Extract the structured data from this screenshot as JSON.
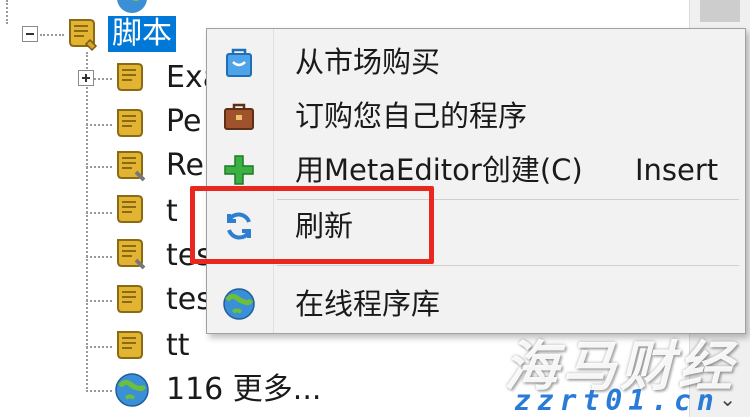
{
  "tree": {
    "root": {
      "label": "脚本",
      "expanded": true
    },
    "children": [
      {
        "label": "Exa",
        "icon": "script-icon",
        "expandable": true
      },
      {
        "label": "Pe",
        "icon": "script-icon",
        "expandable": false
      },
      {
        "label": "Re",
        "icon": "script-icon",
        "expandable": false
      },
      {
        "label": "t",
        "icon": "script-icon",
        "expandable": false
      },
      {
        "label": "tes",
        "icon": "script-icon",
        "expandable": false
      },
      {
        "label": "tes",
        "icon": "script-icon",
        "expandable": false
      },
      {
        "label": "tt",
        "icon": "script-icon",
        "expandable": false
      },
      {
        "label": "116 更多...",
        "icon": "globe-icon",
        "expandable": false
      }
    ]
  },
  "context_menu": {
    "items": [
      {
        "label": "从市场购买",
        "icon": "market-bag-icon",
        "shortcut": ""
      },
      {
        "label": "订购您自己的程序",
        "icon": "briefcase-icon",
        "shortcut": ""
      },
      {
        "label": "用MetaEditor创建(C)",
        "icon": "green-plus-icon",
        "shortcut": "Insert"
      },
      {
        "label": "刷新",
        "icon": "refresh-icon",
        "shortcut": ""
      },
      {
        "label": "在线程序库",
        "icon": "globe-icon",
        "shortcut": ""
      }
    ]
  },
  "colors": {
    "selection": "#0078d7",
    "highlight_box": "#e8271f",
    "watermark_sub": "#2a7bd8"
  },
  "watermark": {
    "main": "海马财经",
    "sub": "zzrt01.cn"
  }
}
